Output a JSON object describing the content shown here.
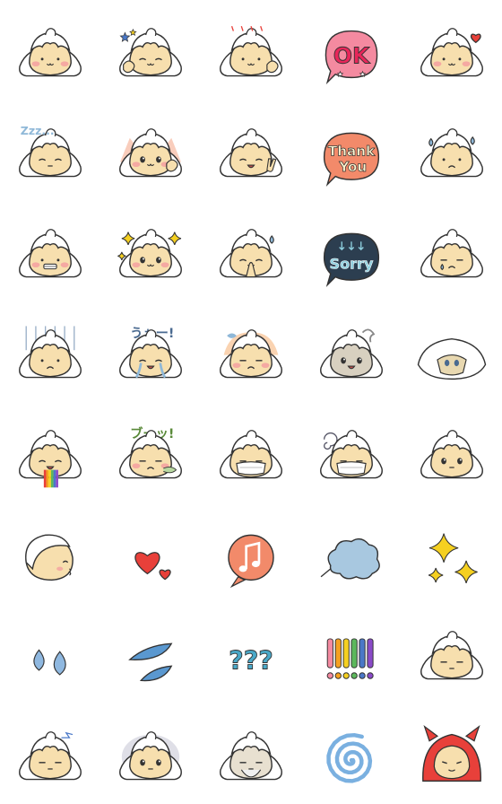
{
  "sheet": {
    "columns": 5,
    "rows": 8,
    "colors": {
      "skin": "#f7dfae",
      "hood": "#ffffff",
      "outline": "#333333",
      "blush": "#f4a0a0",
      "accent_red": "#e8403a",
      "accent_pink": "#f48aa0",
      "accent_blue": "#8fb8d8",
      "accent_yellow": "#f5d020",
      "accent_orange": "#f28a6a"
    },
    "stickers": [
      {
        "icon": "character-blush-icon"
      },
      {
        "icon": "character-thumbs-up-icon"
      },
      {
        "icon": "character-ok-hand-icon"
      },
      {
        "icon": "ok-speech-bubble-icon",
        "text": "OK"
      },
      {
        "icon": "character-heart-icon"
      },
      {
        "icon": "character-sleeping-icon",
        "text": "Zzz..."
      },
      {
        "icon": "character-excited-icon"
      },
      {
        "icon": "character-peace-sign-icon"
      },
      {
        "icon": "thank-you-bubble-icon",
        "text_line1": "Thank",
        "text_line2": "You"
      },
      {
        "icon": "character-sweat-icon"
      },
      {
        "icon": "character-grin-icon"
      },
      {
        "icon": "character-sparkle-icon"
      },
      {
        "icon": "character-pray-icon"
      },
      {
        "icon": "sorry-bubble-icon",
        "text": "Sorry"
      },
      {
        "icon": "character-tear-icon"
      },
      {
        "icon": "character-gloom-icon"
      },
      {
        "icon": "character-crying-icon",
        "text": "うぉー!"
      },
      {
        "icon": "character-angry-icon"
      },
      {
        "icon": "character-shocked-icon"
      },
      {
        "icon": "character-peeking-icon"
      },
      {
        "icon": "character-rainbow-vomit-icon"
      },
      {
        "icon": "character-pout-icon",
        "text": "ブーッ!"
      },
      {
        "icon": "character-mask-icon"
      },
      {
        "icon": "character-mask-dizzy-icon"
      },
      {
        "icon": "character-sad-eyes-icon"
      },
      {
        "icon": "character-kiss-icon"
      },
      {
        "icon": "hearts-icon"
      },
      {
        "icon": "music-note-icon"
      },
      {
        "icon": "puff-cloud-icon"
      },
      {
        "icon": "sparkles-icon"
      },
      {
        "icon": "water-drops-icon"
      },
      {
        "icon": "sweat-drops-icon"
      },
      {
        "icon": "question-marks-icon",
        "text": "???"
      },
      {
        "icon": "exclamation-marks-icon"
      },
      {
        "icon": "character-neutral-icon"
      },
      {
        "icon": "character-scratch-icon"
      },
      {
        "icon": "character-dark-eyes-icon"
      },
      {
        "icon": "character-old-man-icon"
      },
      {
        "icon": "spiral-icon"
      },
      {
        "icon": "character-devil-icon"
      }
    ]
  }
}
